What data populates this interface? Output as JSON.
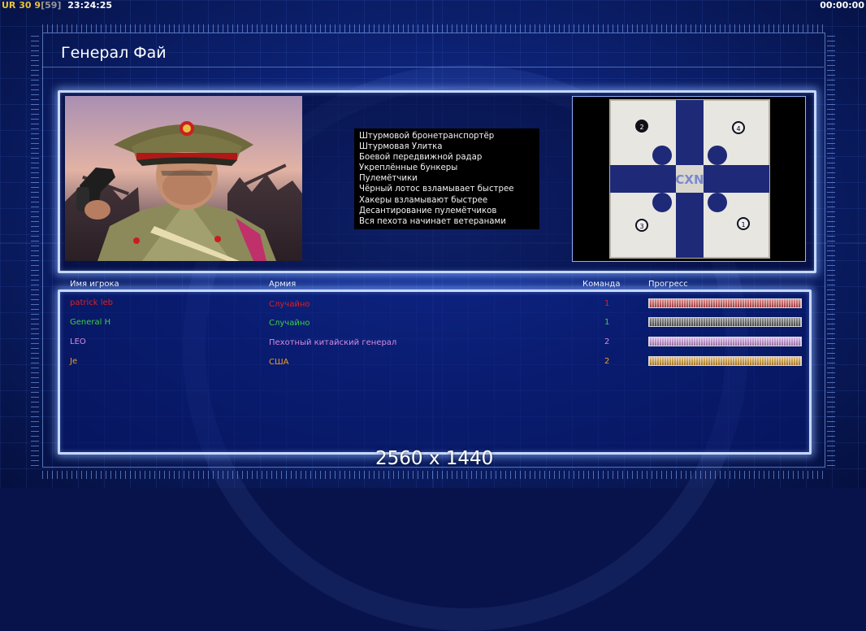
{
  "topbar": {
    "fps_label": "UR",
    "fps_value": "30",
    "frame_count": "9",
    "frame_bracket": "[59]",
    "clock": "23:24:25",
    "game_timer": "00:00:00"
  },
  "page_title": "Генерал Фай",
  "general_features": [
    "Штурмовой бронетранспортёр",
    "Штурмовая Улитка",
    "Боевой передвижной радар",
    "Укреплённые бункеры",
    "Пулемётчики",
    "Чёрный лотос взламывает быстрее",
    "Хакеры взламывают быстрее",
    "Десантирование пулемётчиков",
    "Вся пехота начинает ветеранами"
  ],
  "map": {
    "logo_text": "CXN",
    "start_positions": [
      "1",
      "2",
      "3",
      "4"
    ]
  },
  "players_table": {
    "headers": {
      "name": "Имя игрока",
      "army": "Армия",
      "team": "Команда",
      "progress": "Прогресс"
    },
    "rows": [
      {
        "name": "patrick leb",
        "army": "Случайно",
        "team": "1",
        "color": "#e02020",
        "progress": 1.0,
        "bar_color": "#d05050"
      },
      {
        "name": "General H",
        "army": "Случайно",
        "team": "1",
        "color": "#3ed13e",
        "progress": 1.0,
        "bar_color": "#5a5a5a"
      },
      {
        "name": "LEO",
        "army": "Пехотный китайский генерал",
        "team": "2",
        "color": "#d58ce0",
        "progress": 1.0,
        "bar_color": "#c890d8"
      },
      {
        "name": "Je",
        "army": "США",
        "team": "2",
        "color": "#f0a020",
        "progress": 1.0,
        "bar_color": "#d89a30"
      }
    ]
  },
  "resolution_label": "2560 x 1440"
}
